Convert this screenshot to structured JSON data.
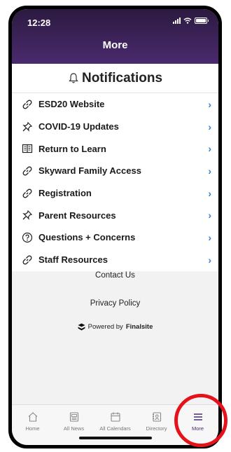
{
  "status_bar": {
    "time": "12:28"
  },
  "header": {
    "title": "More"
  },
  "notifications": {
    "label": "Notifications",
    "icon": "bell-icon"
  },
  "menu": [
    {
      "label": "ESD20 Website",
      "icon": "link-icon"
    },
    {
      "label": "COVID-19 Updates",
      "icon": "pin-icon"
    },
    {
      "label": "Return to Learn",
      "icon": "book-icon"
    },
    {
      "label": "Skyward Family Access",
      "icon": "link-icon"
    },
    {
      "label": "Registration",
      "icon": "link-icon"
    },
    {
      "label": "Parent Resources",
      "icon": "pin-icon"
    },
    {
      "label": "Questions + Concerns",
      "icon": "question-icon"
    },
    {
      "label": "Staff Resources",
      "icon": "link-icon"
    }
  ],
  "footer": {
    "contact": "Contact Us",
    "privacy": "Privacy Policy",
    "powered_prefix": "Powered by",
    "powered_brand": "Finalsite"
  },
  "tabs": [
    {
      "label": "Home",
      "icon": "home-icon"
    },
    {
      "label": "All News",
      "icon": "news-icon"
    },
    {
      "label": "All Calendars",
      "icon": "calendar-icon"
    },
    {
      "label": "Directory",
      "icon": "directory-icon"
    },
    {
      "label": "More",
      "icon": "menu-icon",
      "active": true
    }
  ],
  "colors": {
    "header": "#4a2a6e",
    "chevron": "#2f7fd6",
    "callout": "#e5121a"
  }
}
